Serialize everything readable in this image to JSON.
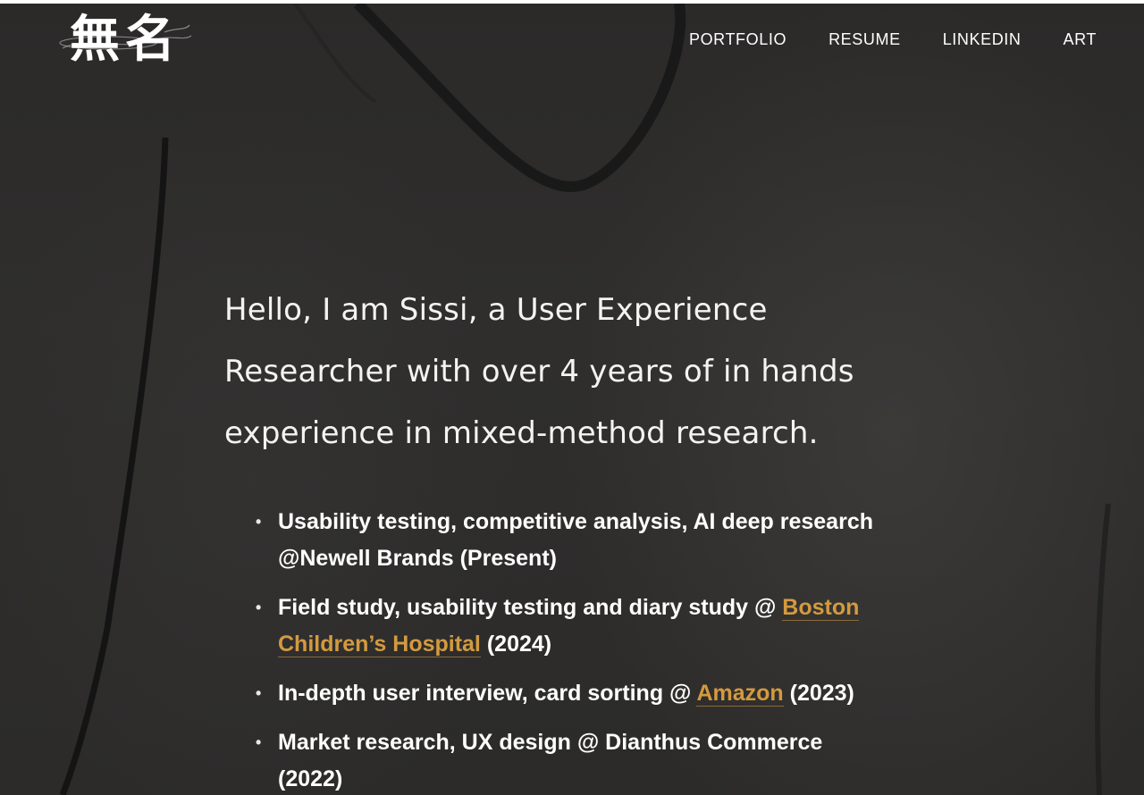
{
  "logo": {
    "text": "無名"
  },
  "nav": {
    "items": [
      {
        "label": "PORTFOLIO"
      },
      {
        "label": "RESUME"
      },
      {
        "label": "LINKEDIN"
      },
      {
        "label": "ART"
      }
    ]
  },
  "intro": {
    "lines": [
      "Hello, I am Sissi, a User Experience",
      "Researcher with over 4 years of in hands",
      "experience in mixed-method research."
    ]
  },
  "experience": {
    "bullet": "•",
    "items": [
      {
        "line1": "Usability testing, competitive analysis, AI deep research",
        "line2": "@Newell Brands (Present)"
      },
      {
        "text": "Field study, usability testing and diary study @ ",
        "link_part1": "Boston",
        "link_part2": "Children’s Hospital",
        "after": " (2024)"
      },
      {
        "text": "In-depth user interview, card sorting @ ",
        "link": "Amazon",
        "after": " (2023)"
      },
      {
        "line1": "Market research, UX design @ Dianthus Commerce",
        "line2": "(2022)"
      }
    ]
  },
  "colors": {
    "background": "#2e2d2c",
    "text": "#ffffff",
    "link": "#d39a3f"
  }
}
